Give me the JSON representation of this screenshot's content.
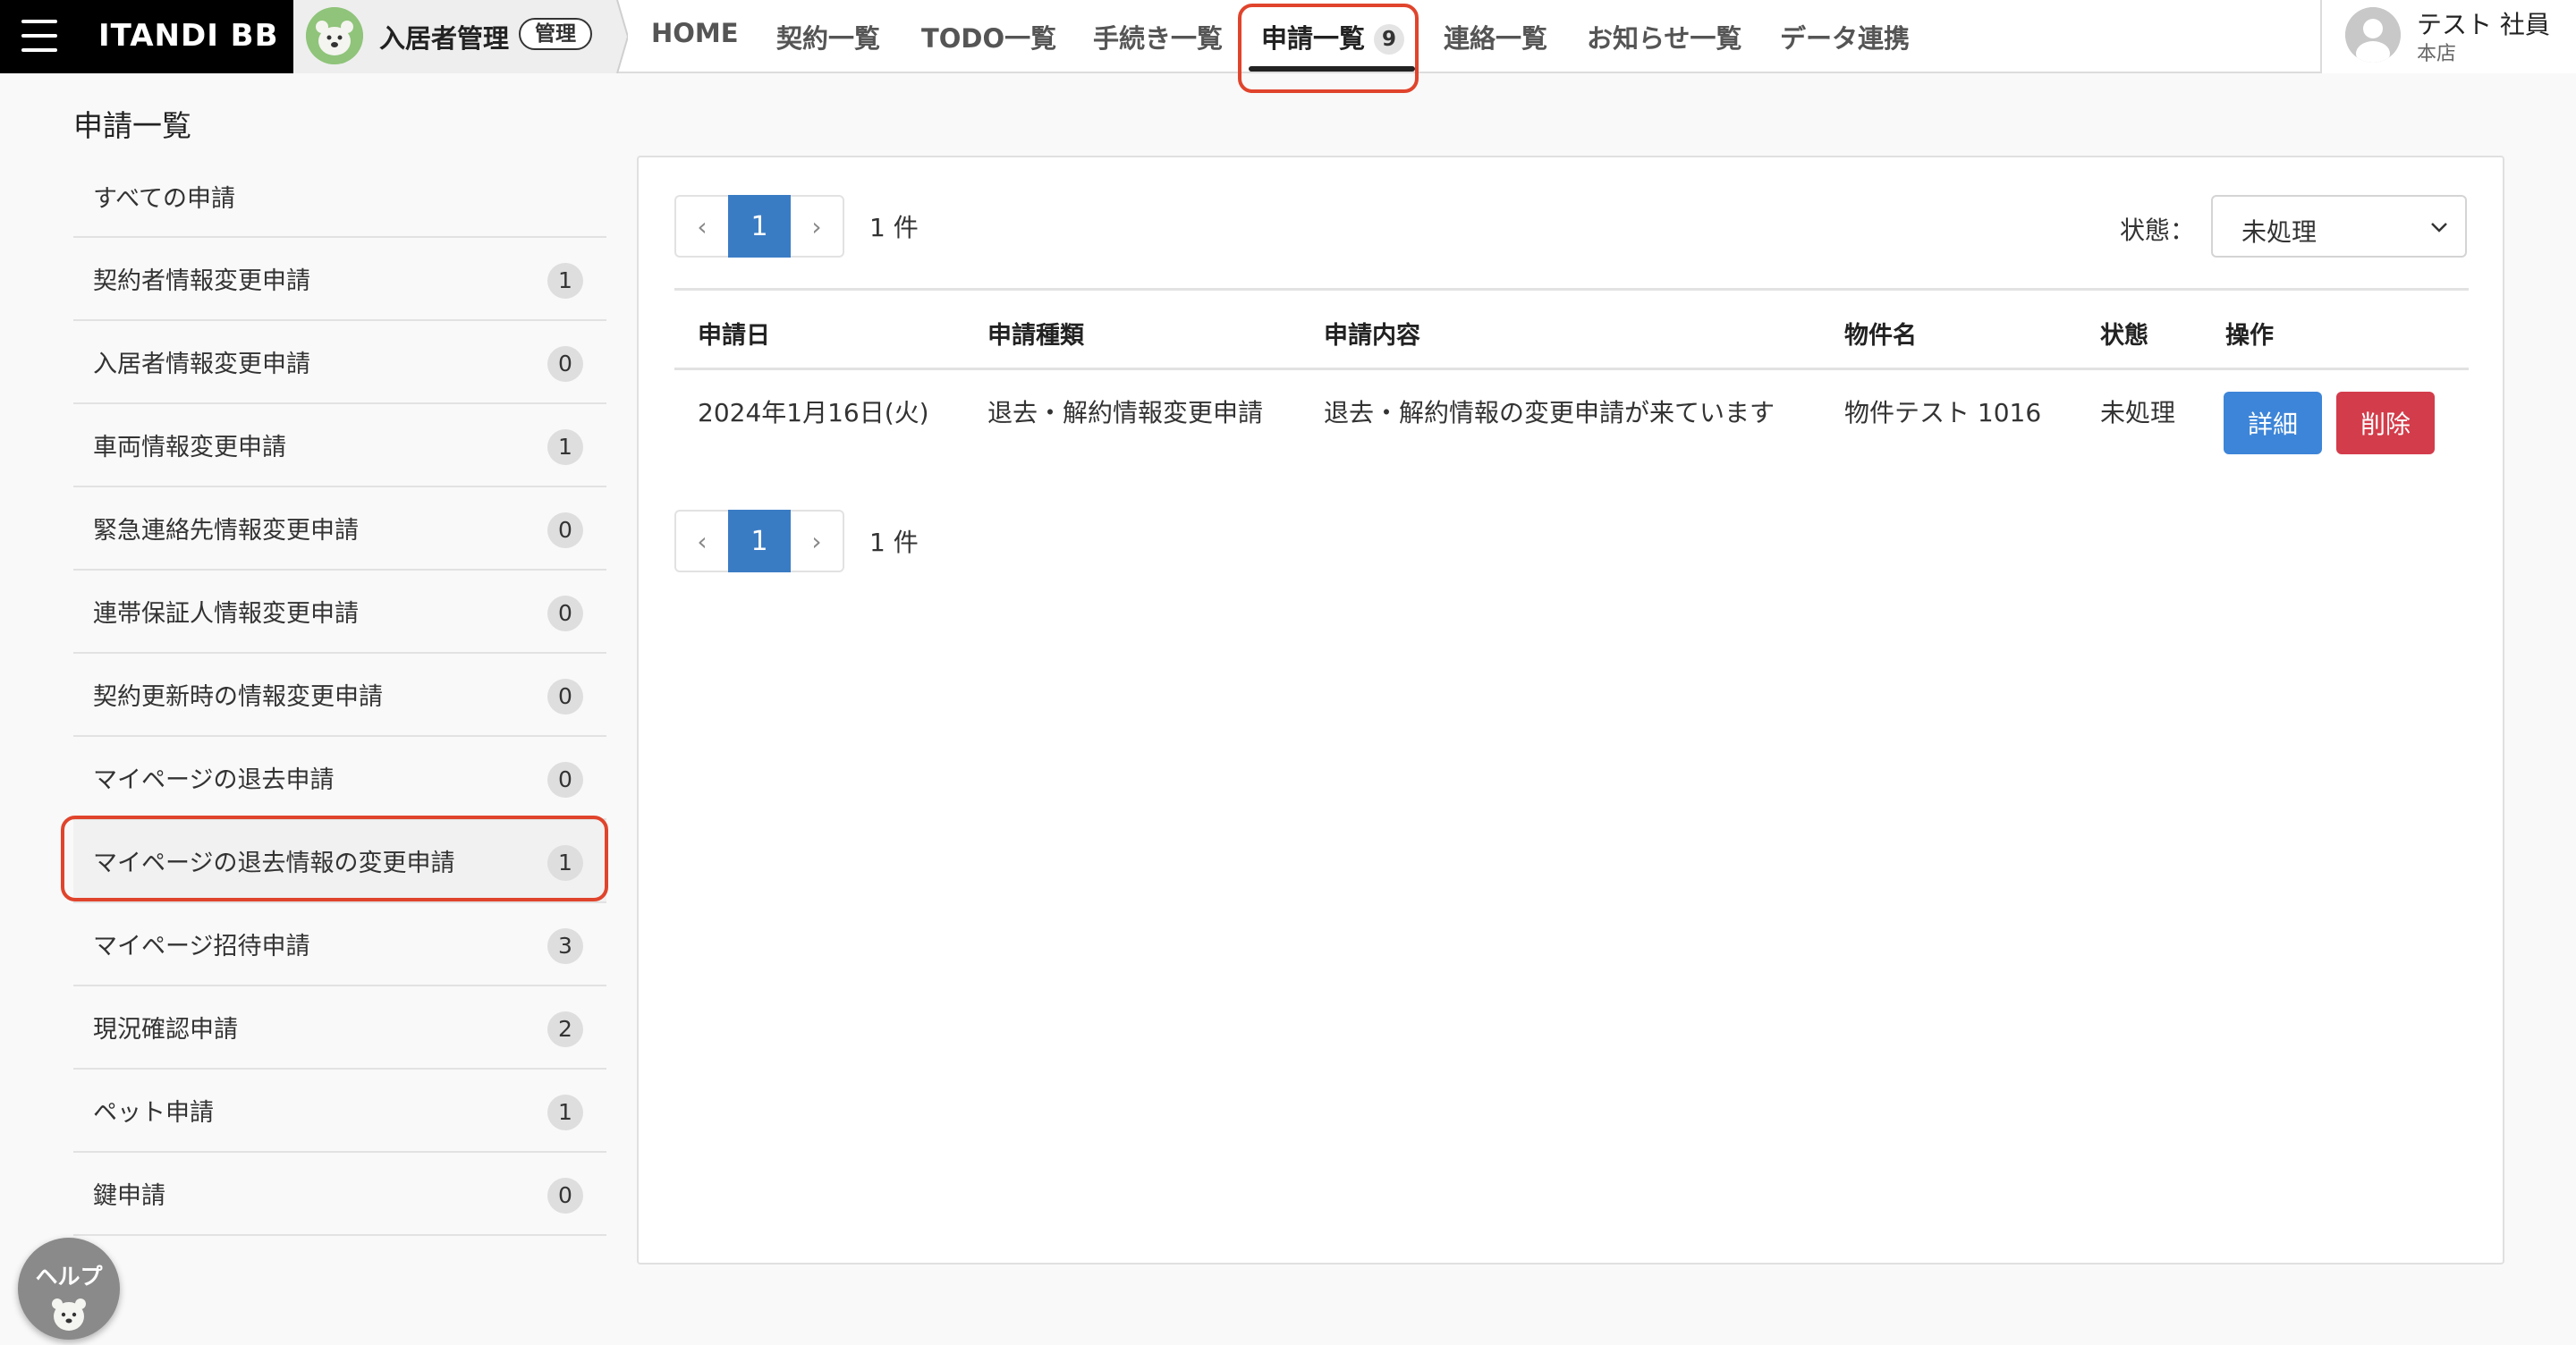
{
  "app": {
    "brand": "ITANDI BB",
    "product_name": "入居者管理",
    "admin_badge": "管理"
  },
  "nav": {
    "items": [
      {
        "label": "HOME"
      },
      {
        "label": "契約一覧"
      },
      {
        "label": "TODO一覧"
      },
      {
        "label": "手続き一覧"
      },
      {
        "label": "申請一覧",
        "badge": "9",
        "active": true
      },
      {
        "label": "連絡一覧"
      },
      {
        "label": "お知らせ一覧"
      },
      {
        "label": "データ連携"
      }
    ]
  },
  "user": {
    "name": "テスト 社員",
    "branch": "本店"
  },
  "page": {
    "title": "申請一覧"
  },
  "sidebar": {
    "items": [
      {
        "label": "すべての申請",
        "count": ""
      },
      {
        "label": "契約者情報変更申請",
        "count": "1"
      },
      {
        "label": "入居者情報変更申請",
        "count": "0"
      },
      {
        "label": "車両情報変更申請",
        "count": "1"
      },
      {
        "label": "緊急連絡先情報変更申請",
        "count": "0"
      },
      {
        "label": "連帯保証人情報変更申請",
        "count": "0"
      },
      {
        "label": "契約更新時の情報変更申請",
        "count": "0"
      },
      {
        "label": "マイページの退去申請",
        "count": "0"
      },
      {
        "label": "マイページの退去情報の変更申請",
        "count": "1",
        "active": true
      },
      {
        "label": "マイページ招待申請",
        "count": "3"
      },
      {
        "label": "現況確認申請",
        "count": "2"
      },
      {
        "label": "ペット申請",
        "count": "1"
      },
      {
        "label": "鍵申請",
        "count": "0"
      }
    ]
  },
  "pagination": {
    "prev": "‹",
    "current": "1",
    "next": "›",
    "count_text": "1 件"
  },
  "filter": {
    "label": "状態：",
    "value": "未処理"
  },
  "table": {
    "headers": [
      "申請日",
      "申請種類",
      "申請内容",
      "物件名",
      "状態",
      "操作"
    ],
    "rows": [
      {
        "date": "2024年1月16日(火)",
        "type": "退去・解約情報変更申請",
        "content": "退去・解約情報の変更申請が来ています",
        "property": "物件テスト 1016",
        "status": "未処理",
        "detail_label": "詳細",
        "delete_label": "削除"
      }
    ]
  },
  "help": {
    "label": "ヘルプ"
  },
  "colors": {
    "accent_blue": "#3a7cc4",
    "detail_blue": "#3d85d8",
    "delete_red": "#d33c4a",
    "highlight_red": "#e0442c"
  }
}
